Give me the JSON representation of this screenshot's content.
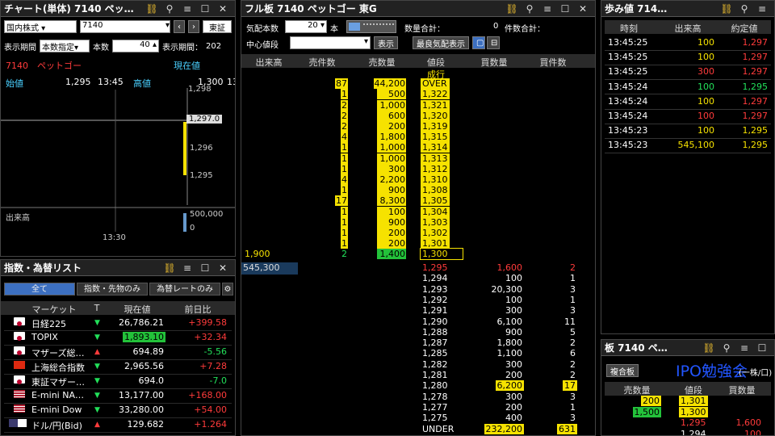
{
  "chart": {
    "title": "チャート(単体) 7140 ペッ…",
    "market": "国内株式",
    "code": "7140",
    "exchange": "東証",
    "period_label": "表示期間",
    "period_value": "本数指定",
    "count_label": "本数",
    "count_value": "40",
    "period_label2": "表示期間：",
    "period_value2": "202",
    "name": "7140　ペットゴー",
    "price_label": "現在値",
    "open_label": "始値",
    "open_value": "1,295",
    "open_time": "13:45",
    "high_label": "高値",
    "high_value": "1,300",
    "high_time": "13",
    "y_ticks": [
      "1,296",
      "1,295"
    ],
    "last_price": "1,297.0",
    "y_top": "1,298",
    "volume_label": "出来高",
    "vol_tick": "500,000",
    "vol_zero": "0",
    "time_tick": "13:30"
  },
  "fullboard": {
    "title": "フル板 7140 ペットゴー 東G",
    "depth_label": "気配本数",
    "depth_value": "20",
    "depth_unit": "本",
    "qty_total_label": "数量合計：",
    "qty_total_value": "0",
    "count_total_label": "件数合計：",
    "center_label": "中心値段",
    "show_button": "表示",
    "best_button": "最良気配表示",
    "headers": [
      "出来高",
      "売件数",
      "売数量",
      "値段",
      "買数量",
      "買件数"
    ],
    "sell_rows": [
      {
        "cnt": "",
        "qty": "",
        "price": "成行"
      },
      {
        "cnt": "87",
        "qty": "44,200",
        "price": "OVER"
      },
      {
        "cnt": "1",
        "qty": "500",
        "price": "1,322"
      },
      {
        "cnt": "2",
        "qty": "1,000",
        "price": "1,321"
      },
      {
        "cnt": "2",
        "qty": "600",
        "price": "1,320"
      },
      {
        "cnt": "2",
        "qty": "200",
        "price": "1,319"
      },
      {
        "cnt": "4",
        "qty": "1,800",
        "price": "1,315"
      },
      {
        "cnt": "1",
        "qty": "1,000",
        "price": "1,314"
      },
      {
        "cnt": "1",
        "qty": "1,000",
        "price": "1,313"
      },
      {
        "cnt": "1",
        "qty": "300",
        "price": "1,312"
      },
      {
        "cnt": "4",
        "qty": "2,200",
        "price": "1,310"
      },
      {
        "cnt": "1",
        "qty": "900",
        "price": "1,308"
      },
      {
        "cnt": "17",
        "qty": "8,300",
        "price": "1,305"
      },
      {
        "cnt": "1",
        "qty": "100",
        "price": "1,304"
      },
      {
        "cnt": "1",
        "qty": "900",
        "price": "1,303"
      },
      {
        "cnt": "1",
        "qty": "200",
        "price": "1,302"
      },
      {
        "cnt": "1",
        "qty": "200",
        "price": "1,301"
      },
      {
        "vol": "1,900",
        "cnt": "2",
        "qty": "1,400",
        "price": "1,300"
      }
    ],
    "total_volume": "545,300",
    "buy_rows": [
      {
        "price": "1,295",
        "qty": "1,600",
        "cnt": "2"
      },
      {
        "price": "1,294",
        "qty": "100",
        "cnt": "1"
      },
      {
        "price": "1,293",
        "qty": "20,300",
        "cnt": "3"
      },
      {
        "price": "1,292",
        "qty": "100",
        "cnt": "1"
      },
      {
        "price": "1,291",
        "qty": "300",
        "cnt": "3"
      },
      {
        "price": "1,290",
        "qty": "6,100",
        "cnt": "11"
      },
      {
        "price": "1,288",
        "qty": "900",
        "cnt": "5"
      },
      {
        "price": "1,287",
        "qty": "1,800",
        "cnt": "2"
      },
      {
        "price": "1,285",
        "qty": "1,100",
        "cnt": "6"
      },
      {
        "price": "1,282",
        "qty": "300",
        "cnt": "2"
      },
      {
        "price": "1,281",
        "qty": "200",
        "cnt": "2"
      },
      {
        "price": "1,280",
        "qty": "6,200",
        "cnt": "17"
      },
      {
        "price": "1,278",
        "qty": "300",
        "cnt": "3"
      },
      {
        "price": "1,277",
        "qty": "200",
        "cnt": "1"
      },
      {
        "price": "1,275",
        "qty": "400",
        "cnt": "3"
      },
      {
        "price": "UNDER",
        "qty": "232,200",
        "cnt": "631"
      }
    ]
  },
  "ticks": {
    "title": "歩み値 714…",
    "headers": [
      "時刻",
      "出来高",
      "約定値"
    ],
    "rows": [
      {
        "time": "13:45:25",
        "vol": "100",
        "price": "1,297",
        "vc": "yel",
        "pc": "red"
      },
      {
        "time": "13:45:25",
        "vol": "100",
        "price": "1,297",
        "vc": "yel",
        "pc": "red"
      },
      {
        "time": "13:45:25",
        "vol": "300",
        "price": "1,297",
        "vc": "red",
        "pc": "red"
      },
      {
        "time": "13:45:24",
        "vol": "100",
        "price": "1,295",
        "vc": "grn",
        "pc": "grn"
      },
      {
        "time": "13:45:24",
        "vol": "100",
        "price": "1,297",
        "vc": "yel",
        "pc": "red"
      },
      {
        "time": "13:45:24",
        "vol": "100",
        "price": "1,297",
        "vc": "red",
        "pc": "red"
      },
      {
        "time": "13:45:23",
        "vol": "100",
        "price": "1,295",
        "vc": "yel",
        "pc": "yel"
      },
      {
        "time": "13:45:23",
        "vol": "545,100",
        "price": "1,295",
        "vc": "yel",
        "pc": "yel"
      }
    ]
  },
  "indices": {
    "title": "指数・為替リスト",
    "tabs": [
      "全て",
      "指数・先物のみ",
      "為替レートのみ"
    ],
    "headers": [
      "マーケット",
      "T",
      "現在値",
      "前日比"
    ],
    "rows": [
      {
        "name": "日経225",
        "dir": "down",
        "price": "26,786.21",
        "chg": "+399.58",
        "flag": "jp",
        "box": false,
        "cc": "red"
      },
      {
        "name": "TOPIX",
        "dir": "down",
        "price": "1,893.10",
        "chg": "+32.34",
        "flag": "jp",
        "box": true,
        "cc": "red"
      },
      {
        "name": "マザーズ総…",
        "dir": "up",
        "price": "694.89",
        "chg": "-5.56",
        "flag": "jp",
        "box": false,
        "cc": "grn"
      },
      {
        "name": "上海総合指数",
        "dir": "down",
        "price": "2,965.56",
        "chg": "+7.28",
        "flag": "cn",
        "box": false,
        "cc": "red"
      },
      {
        "name": "東証マザー…",
        "dir": "down",
        "price": "694.0",
        "chg": "-7.0",
        "flag": "jp",
        "box": false,
        "cc": "grn"
      },
      {
        "name": "E-mini NA…",
        "dir": "down",
        "price": "13,177.00",
        "chg": "+168.00",
        "flag": "us",
        "box": false,
        "cc": "red"
      },
      {
        "name": "E-mini Dow",
        "dir": "down",
        "price": "33,280.00",
        "chg": "+54.00",
        "flag": "us",
        "box": false,
        "cc": "red"
      },
      {
        "name": "ドル/円(Bid)",
        "dir": "up",
        "price": "129.682",
        "chg": "+1.264",
        "flag": "usjp",
        "box": false,
        "cc": "red"
      }
    ]
  },
  "miniboard": {
    "title": "板 7140 ペ…",
    "compound_button": "複合板",
    "overlay_text": "IPO勉強会",
    "unit_text": "(一株/口)",
    "headers": [
      "売数量",
      "値段",
      "買数量"
    ],
    "rows": [
      {
        "sell": "200",
        "price": "1,301",
        "buy": "",
        "sb": "ybox",
        "pb": "ybox",
        "pc": ""
      },
      {
        "sell": "1,500",
        "price": "1,300",
        "buy": "",
        "sb": "gbox",
        "pb": "ybox",
        "pc": ""
      },
      {
        "sell": "",
        "price": "1,295",
        "buy": "1,600",
        "sb": "",
        "pb": "",
        "pc": "red"
      },
      {
        "sell": "",
        "price": "1,294",
        "buy": "100",
        "sb": "",
        "pb": "",
        "pc": ""
      }
    ]
  }
}
